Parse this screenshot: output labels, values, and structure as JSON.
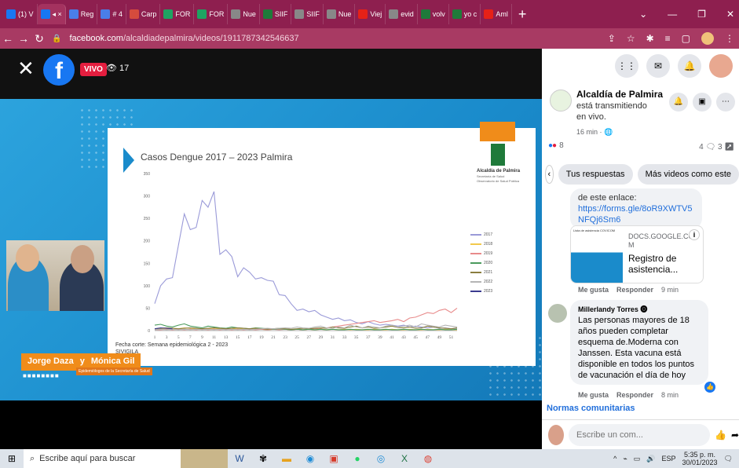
{
  "browser": {
    "tabs": [
      {
        "label": "(1) V",
        "color": "#1877f2"
      },
      {
        "label": "◂ ×",
        "color": "#1877f2",
        "active": true
      },
      {
        "label": "Reg",
        "color": "#4a7ee8"
      },
      {
        "label": "# 4",
        "color": "#4a7ee8"
      },
      {
        "label": "Carp",
        "color": "#d54b3d"
      },
      {
        "label": "FOR",
        "color": "#1ea362"
      },
      {
        "label": "FOR",
        "color": "#1ea362"
      },
      {
        "label": "Nue",
        "color": "#888888"
      },
      {
        "label": "SIIF",
        "color": "#1f7a3a"
      },
      {
        "label": "SIIF",
        "color": "#888888"
      },
      {
        "label": "Nue",
        "color": "#888888"
      },
      {
        "label": "Viej",
        "color": "#e62117"
      },
      {
        "label": "evid",
        "color": "#888888"
      },
      {
        "label": "volv",
        "color": "#1f7a3a"
      },
      {
        "label": "yo c",
        "color": "#1f7a3a"
      },
      {
        "label": "Aml",
        "color": "#e62117"
      }
    ],
    "new_tab": "+",
    "url_host": "facebook.com",
    "url_path": "/alcaldiadepalmira/videos/1911787342546637"
  },
  "video": {
    "live_badge": "VIVO",
    "viewers": "17",
    "slide": {
      "title": "Casos Dengue 2017 – 2023 Palmira",
      "org_name": "Alcaldía de Palmira",
      "org_sub": "Secretaría de Salud\nObservatorio de Salud Pública",
      "source_line1": "Fecha corte: Semana epidemiológica 2 - 2023",
      "source_line2": "SIVIGILA"
    },
    "presenters": {
      "name1": "Jorge Daza",
      "joiner": "y",
      "name2": "Mónica Gil",
      "role": "Epidemiólogos de la Secretaría de Salud"
    }
  },
  "chart_data": {
    "type": "line",
    "title": "Casos Dengue 2017 – 2023 Palmira",
    "ylim": [
      0,
      350
    ],
    "yticks": [
      0,
      50,
      100,
      150,
      200,
      250,
      300,
      350
    ],
    "xticks": [
      1,
      3,
      5,
      7,
      9,
      11,
      13,
      15,
      17,
      19,
      21,
      23,
      25,
      27,
      29,
      31,
      33,
      35,
      37,
      39,
      41,
      43,
      45,
      47,
      49,
      51
    ],
    "x": [
      1,
      2,
      3,
      4,
      5,
      6,
      7,
      8,
      9,
      10,
      11,
      12,
      13,
      14,
      15,
      16,
      17,
      18,
      19,
      20,
      21,
      22,
      23,
      24,
      25,
      26,
      27,
      28,
      29,
      30,
      31,
      32,
      33,
      34,
      35,
      36,
      37,
      38,
      39,
      40,
      41,
      42,
      43,
      44,
      45,
      46,
      47,
      48,
      49,
      50,
      51,
      52
    ],
    "series": [
      {
        "name": "2017",
        "color": "#9a9ad8",
        "values": [
          60,
          100,
          115,
          118,
          190,
          260,
          225,
          230,
          290,
          275,
          310,
          170,
          180,
          165,
          120,
          140,
          130,
          115,
          118,
          112,
          110,
          80,
          78,
          60,
          45,
          48,
          42,
          45,
          35,
          30,
          25,
          28,
          22,
          24,
          18,
          15,
          20,
          15,
          12,
          14,
          12,
          10,
          12,
          8,
          10,
          8,
          6,
          8,
          5,
          6,
          4,
          5
        ]
      },
      {
        "name": "2018",
        "color": "#f2c94c",
        "values": [
          3,
          4,
          3,
          5,
          4,
          6,
          5,
          4,
          3,
          4,
          5,
          4,
          3,
          4,
          5,
          4,
          3,
          4,
          3,
          2,
          3,
          4,
          3,
          2,
          3,
          2,
          3,
          2,
          3,
          2,
          3,
          2,
          3,
          2,
          3,
          2,
          2,
          3,
          2,
          2,
          3,
          2,
          2,
          3,
          2,
          2,
          3,
          2,
          2,
          3,
          2,
          2
        ]
      },
      {
        "name": "2019",
        "color": "#e88b8b",
        "values": [
          2,
          2,
          3,
          2,
          3,
          2,
          3,
          2,
          3,
          2,
          3,
          2,
          3,
          2,
          3,
          2,
          3,
          2,
          3,
          2,
          3,
          2,
          3,
          2,
          3,
          2,
          3,
          4,
          5,
          6,
          8,
          10,
          12,
          14,
          16,
          18,
          20,
          22,
          18,
          20,
          22,
          25,
          20,
          28,
          30,
          35,
          40,
          38,
          45,
          48,
          40,
          50
        ]
      },
      {
        "name": "2020",
        "color": "#4a9b5c",
        "values": [
          12,
          14,
          10,
          8,
          12,
          15,
          10,
          8,
          6,
          10,
          8,
          6,
          5,
          8,
          6,
          5,
          4,
          6,
          5,
          4,
          3,
          4,
          3,
          2,
          3,
          2,
          3,
          2,
          3,
          2,
          3,
          2,
          2,
          3,
          2,
          2,
          3,
          2,
          2,
          3,
          2,
          2,
          3,
          2,
          2,
          3,
          2,
          2,
          3,
          2,
          2,
          3
        ]
      },
      {
        "name": "2021",
        "color": "#8a7d3e",
        "values": [
          4,
          5,
          6,
          5,
          4,
          5,
          6,
          5,
          4,
          5,
          6,
          5,
          4,
          5,
          6,
          5,
          4,
          5,
          4,
          3,
          4,
          5,
          4,
          3,
          4,
          5,
          4,
          5,
          6,
          5,
          8,
          6,
          5,
          8,
          10,
          6,
          8,
          5,
          6,
          8,
          10,
          7,
          6,
          8,
          5,
          6,
          10,
          8,
          6,
          5,
          4,
          6
        ]
      },
      {
        "name": "2022",
        "color": "#b5b5b5",
        "values": [
          2,
          3,
          2,
          3,
          2,
          3,
          2,
          3,
          2,
          3,
          2,
          3,
          2,
          3,
          2,
          3,
          2,
          3,
          4,
          5,
          4,
          5,
          6,
          5,
          8,
          6,
          5,
          8,
          10,
          6,
          5,
          8,
          6,
          12,
          8,
          6,
          10,
          8,
          6,
          10,
          12,
          8,
          10,
          12,
          8,
          15,
          12,
          10,
          8,
          12,
          10,
          8
        ]
      },
      {
        "name": "2023",
        "color": "#3b3b8f",
        "values": [
          4,
          6,
          5,
          4,
          null,
          null,
          null,
          null,
          null,
          null,
          null,
          null,
          null,
          null,
          null,
          null,
          null,
          null,
          null,
          null,
          null,
          null,
          null,
          null,
          null,
          null,
          null,
          null,
          null,
          null,
          null,
          null,
          null,
          null,
          null,
          null,
          null,
          null,
          null,
          null,
          null,
          null,
          null,
          null,
          null,
          null,
          null,
          null,
          null,
          null,
          null,
          null
        ]
      }
    ]
  },
  "panel": {
    "page_name": "Alcaldía de Palmira",
    "status": "está transmitiendo en vivo.",
    "time": "16 min · ",
    "reactions": "8",
    "comments": "4",
    "shares": "3",
    "chips": [
      "Tus respuestas",
      "Más videos como este"
    ],
    "comment1_text1": "de este enlace:",
    "comment1_link": "https://forms.gle/8oR9XWTV5NFQj6Sm6",
    "link_card": {
      "domain": "DOCS.GOOGLE.COM",
      "title": "Registro de asistencia...",
      "thumb_label": "Lista de asistencia COVICOM"
    },
    "comment1_actions": {
      "like": "Me gusta",
      "reply": "Responder",
      "time": "9 min"
    },
    "comment2": {
      "author": "Millerlandy Torres",
      "text": "Las personas mayores de 18 años pueden completar esquema de.Moderna con Janssen. Esta vacuna está disponible en todos los puntos de vacunación el día de hoy"
    },
    "comment2_actions": {
      "like": "Me gusta",
      "reply": "Responder",
      "time": "8 min"
    },
    "norms": "Normas comunitarias",
    "write_placeholder": "Escribe un com..."
  },
  "taskbar": {
    "search_placeholder": "Escribe aquí para buscar",
    "language": "ESP",
    "time": "5:35 p. m.",
    "date": "30/01/2023"
  }
}
